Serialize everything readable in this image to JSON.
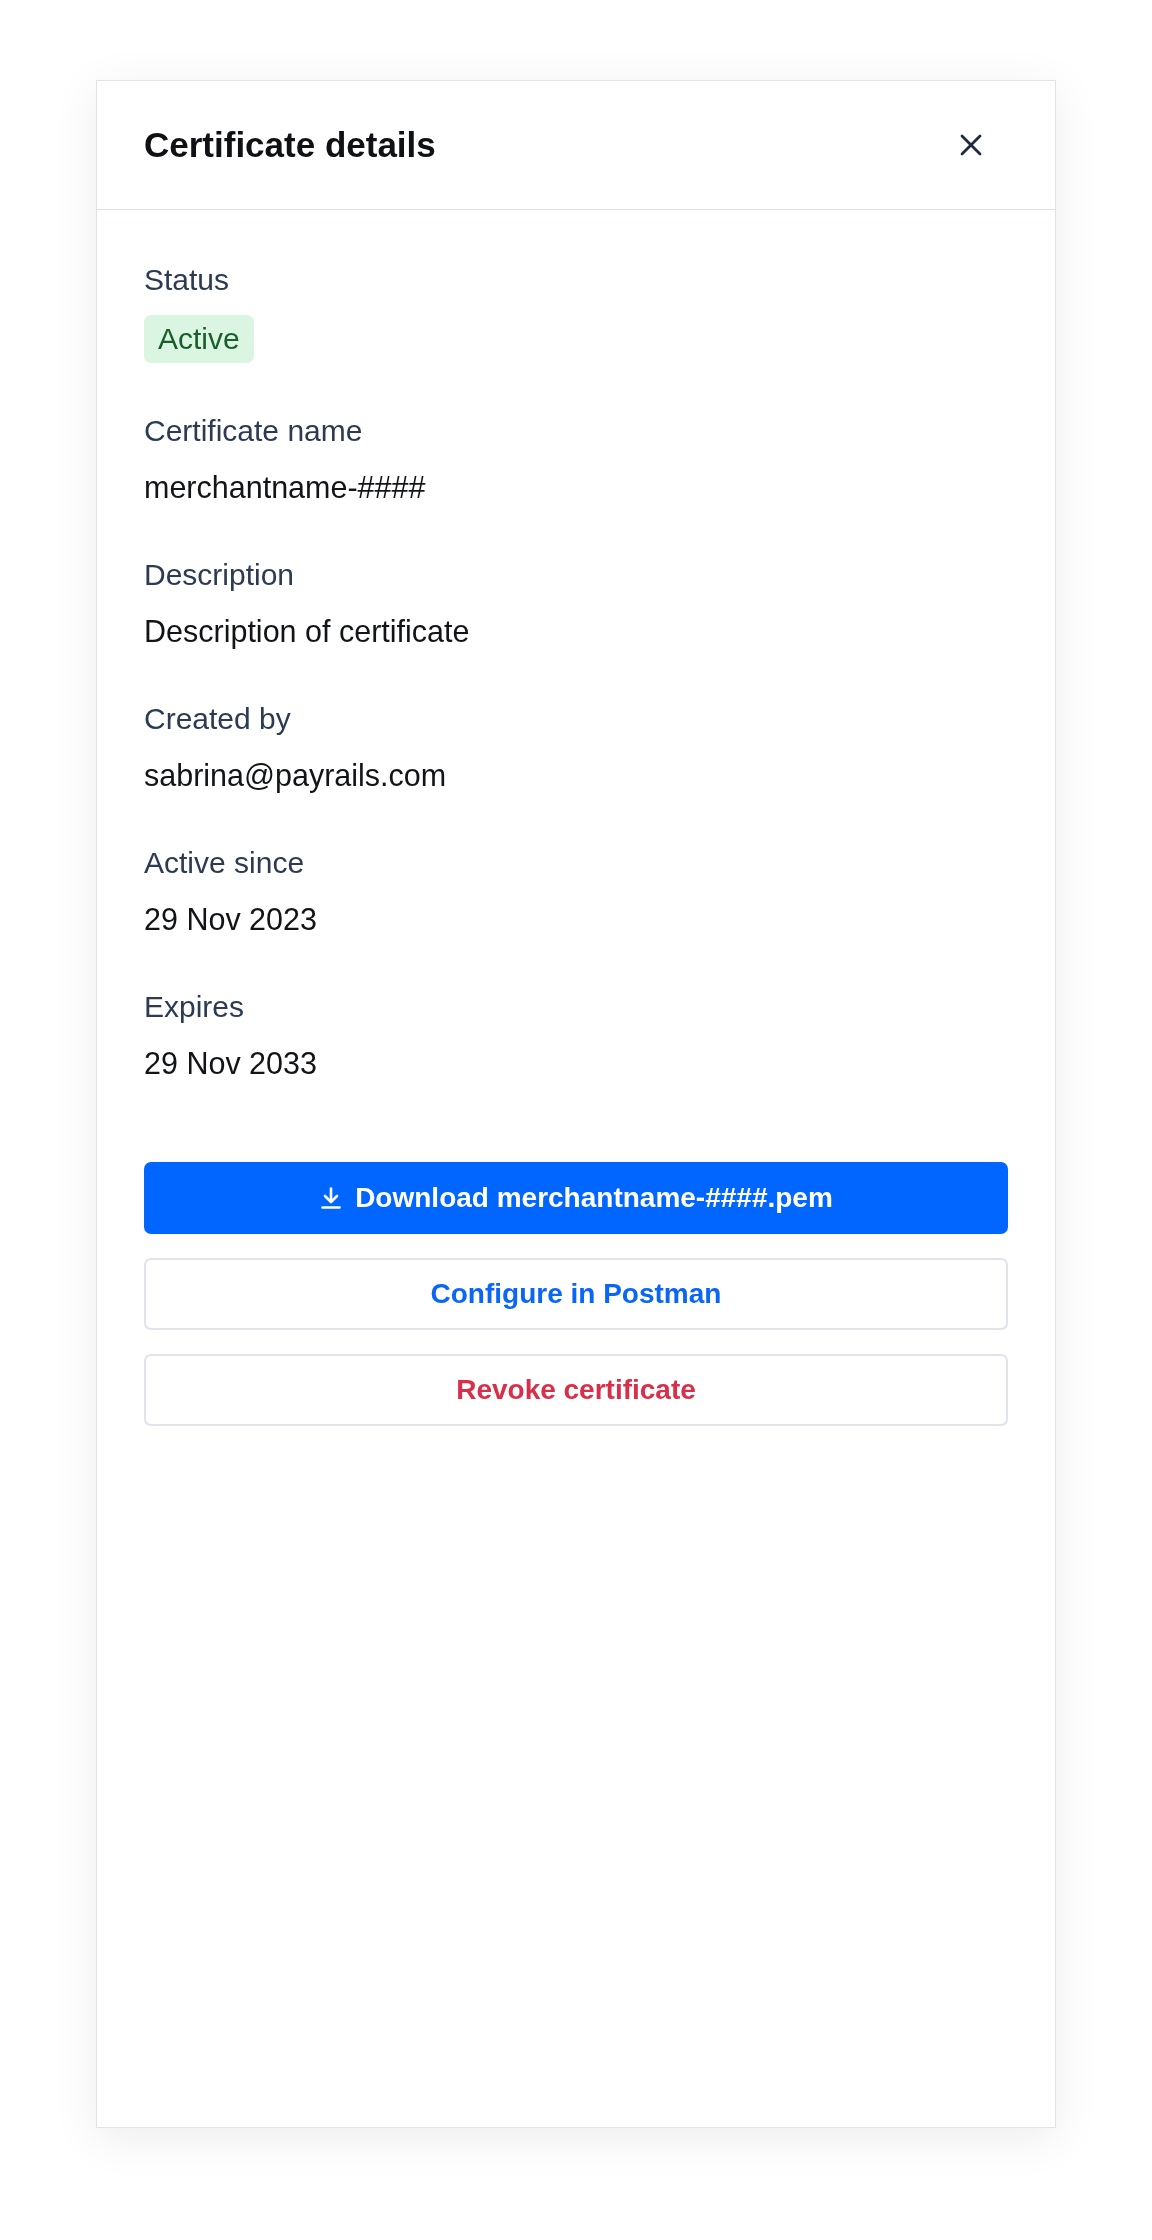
{
  "panel": {
    "title": "Certificate details"
  },
  "fields": [
    {
      "label": "Status",
      "value": "Active",
      "kind": "badge"
    },
    {
      "label": "Certificate name",
      "value": "merchantname-####",
      "kind": "text"
    },
    {
      "label": "Description",
      "value": "Description of certificate",
      "kind": "text"
    },
    {
      "label": "Created by",
      "value": "sabrina@payrails.com",
      "kind": "text"
    },
    {
      "label": "Active since",
      "value": "29 Nov 2023",
      "kind": "text"
    },
    {
      "label": "Expires",
      "value": "29 Nov 2033",
      "kind": "text"
    }
  ],
  "actions": [
    {
      "label": "Download merchantname-####.pem",
      "kind": "download"
    },
    {
      "label": "Configure in Postman",
      "kind": "link"
    },
    {
      "label": "Revoke certificate",
      "kind": "danger"
    }
  ]
}
